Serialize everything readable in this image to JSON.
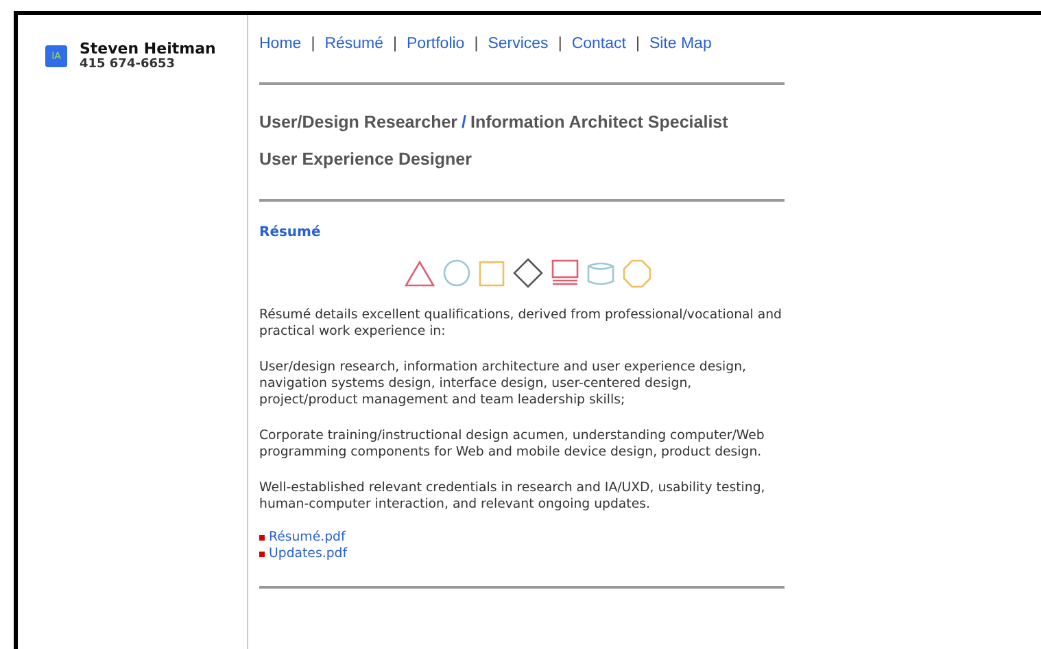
{
  "sidebar": {
    "logo": "IA",
    "name": "Steven Heitman",
    "phone": "415 674-6653"
  },
  "nav": [
    "Home",
    "Résumé",
    "Portfolio",
    "Services",
    "Contact",
    "Site Map"
  ],
  "nav_separator": "|",
  "headline": {
    "first": "User/Design Researcher",
    "separator": "/",
    "second": "Information Architect Specialist"
  },
  "subheadline": "User Experience Designer",
  "section": {
    "title": "Résumé",
    "paragraphs": [
      "Résumé details excellent qualifications, derived from professional/vocational and practical work experience in:",
      "User/design research, information architecture and user experience design, navigation systems design, interface design, user-centered design, project/product management and team leadership skills;",
      "Corporate training/instructional design acumen, understanding computer/Web programming components for Web and mobile device design, product design.",
      "Well-established relevant credentials in research and IA/UXD, usability testing, human-computer interaction, and relevant ongoing updates."
    ],
    "links": [
      "Résumé.pdf",
      "Updates.pdf"
    ]
  }
}
